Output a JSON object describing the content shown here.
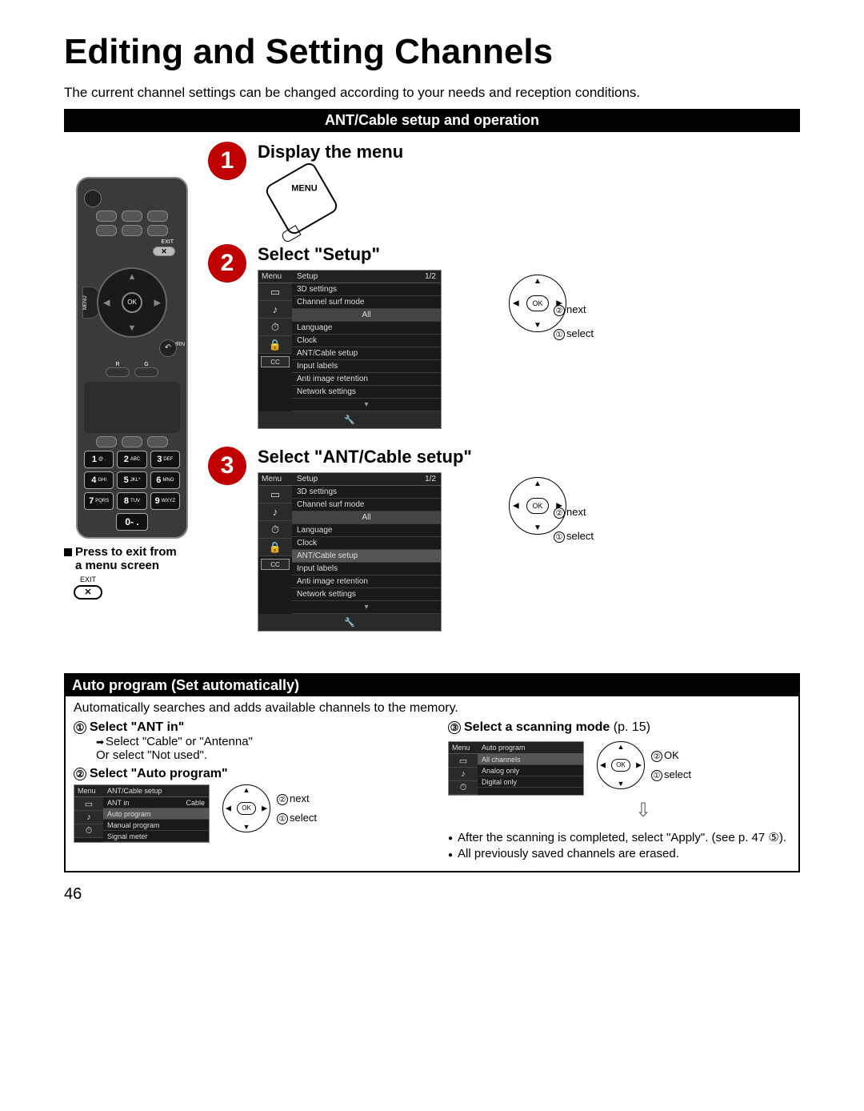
{
  "title": "Editing and Setting Channels",
  "intro": "The current channel settings can be changed according to your needs and reception conditions.",
  "section_bar": "ANT/Cable setup and operation",
  "remote": {
    "exit": "EXIT",
    "ok": "OK",
    "menu": "MENU",
    "return": "RETURN",
    "r": "R",
    "g": "G",
    "keys": {
      "1": "1",
      "1sub": "@ .",
      "2": "2",
      "2sub": "ABC",
      "3": "3",
      "3sub": "DEF",
      "4": "4",
      "4sub": "GHI",
      "5": "5",
      "5sub": "JKL*",
      "6": "6",
      "6sub": "MNO",
      "7": "7",
      "7sub": "PQRS",
      "8": "8",
      "8sub": "TUV",
      "9": "9",
      "9sub": "WXYZ",
      "0": "0",
      "0sub": "- ."
    }
  },
  "press_exit": {
    "line1": "Press to exit from",
    "line2": "a menu screen",
    "key_label": "EXIT",
    "key_x": "✕"
  },
  "steps": {
    "s1": {
      "num": "1",
      "title": "Display the menu",
      "menu_btn": "MENU"
    },
    "s2": {
      "num": "2",
      "title": "Select \"Setup\"",
      "menu_header_left": "Menu",
      "menu_header_right": "Setup",
      "page": "1/2",
      "items": [
        "3D settings",
        "Channel surf mode",
        "All",
        "Language",
        "Clock",
        "ANT/Cable setup",
        "Input labels",
        "Anti image retention",
        "Network settings"
      ],
      "nav": {
        "ok": "OK",
        "l2": "next",
        "l1": "select",
        "n2": "②",
        "n1": "①"
      }
    },
    "s3": {
      "num": "3",
      "title": "Select \"ANT/Cable setup\"",
      "menu_header_left": "Menu",
      "menu_header_right": "Setup",
      "page": "1/2",
      "items": [
        "3D settings",
        "Channel surf mode",
        "All",
        "Language",
        "Clock",
        "ANT/Cable setup",
        "Input labels",
        "Anti image retention",
        "Network settings"
      ],
      "highlight_index": 5,
      "nav": {
        "ok": "OK",
        "l2": "next",
        "l1": "select",
        "n2": "②",
        "n1": "①"
      }
    }
  },
  "auto": {
    "header": "Auto program (Set automatically)",
    "intro": "Automatically searches and adds available channels to the memory.",
    "step1": {
      "num": "①",
      "title": "Select \"ANT in\"",
      "body1": "Select \"Cable\" or \"Antenna\"",
      "body2": "Or select \"Not used\"."
    },
    "step2": {
      "num": "②",
      "title": "Select \"Auto program\"",
      "menu_hdr_l": "Menu",
      "menu_hdr_r": "ANT/Cable setup",
      "rows": [
        {
          "label": "ANT in",
          "value": "Cable"
        },
        {
          "label": "Auto program",
          "value": ""
        },
        {
          "label": "Manual program",
          "value": ""
        },
        {
          "label": "Signal meter",
          "value": ""
        }
      ],
      "nav": {
        "ok": "OK",
        "l2": "next",
        "l1": "select",
        "n2": "②",
        "n1": "①"
      }
    },
    "step3": {
      "num": "③",
      "title": "Select a scanning mode",
      "pref": "(p. 15)",
      "menu_hdr_l": "Menu",
      "menu_hdr_r": "Auto program",
      "rows": [
        "All channels",
        "Analog only",
        "Digital only"
      ],
      "nav": {
        "ok": "OK",
        "l2": "OK",
        "l1": "select",
        "n2": "②",
        "n1": "①"
      },
      "bullets": [
        "After the scanning is completed, select \"Apply\". (see p. 47 ⑤).",
        "All previously saved channels are erased."
      ]
    }
  },
  "page_number": "46"
}
